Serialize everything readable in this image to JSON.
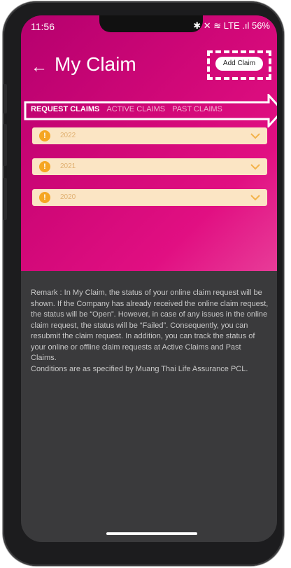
{
  "status_bar": {
    "time": "11:56",
    "icons_text": "✱ ✕ ≋ LTE .ıl 56%",
    "battery": "56%"
  },
  "header": {
    "title": "My Claim",
    "add_button": "Add Claim"
  },
  "tabs": [
    {
      "label": "REQUEST CLAIMS",
      "active": true
    },
    {
      "label": "ACTIVE CLAIMS",
      "active": false
    },
    {
      "label": "PAST CLAIMS",
      "active": false
    }
  ],
  "years": [
    {
      "label": "2022"
    },
    {
      "label": "2021"
    },
    {
      "label": "2020"
    }
  ],
  "remark": {
    "paragraph1": "Remark : In My Claim, the status of your online claim request will be shown. If the Company has already received the online claim request, the status will be “Open”. However, in case of any issues in the online claim request, the status will be “Failed”. Consequently, you can resubmit the claim request. In addition, you can track the status of your online or offline claim requests at Active Claims and Past Claims.",
    "paragraph2": "Conditions are as specified by Muang Thai Life Assurance PCL."
  },
  "colors": {
    "brand_pink": "#d10878",
    "row_bg": "#fbe5c4",
    "warn": "#f5a623",
    "body_bg": "#3a3a3c"
  }
}
